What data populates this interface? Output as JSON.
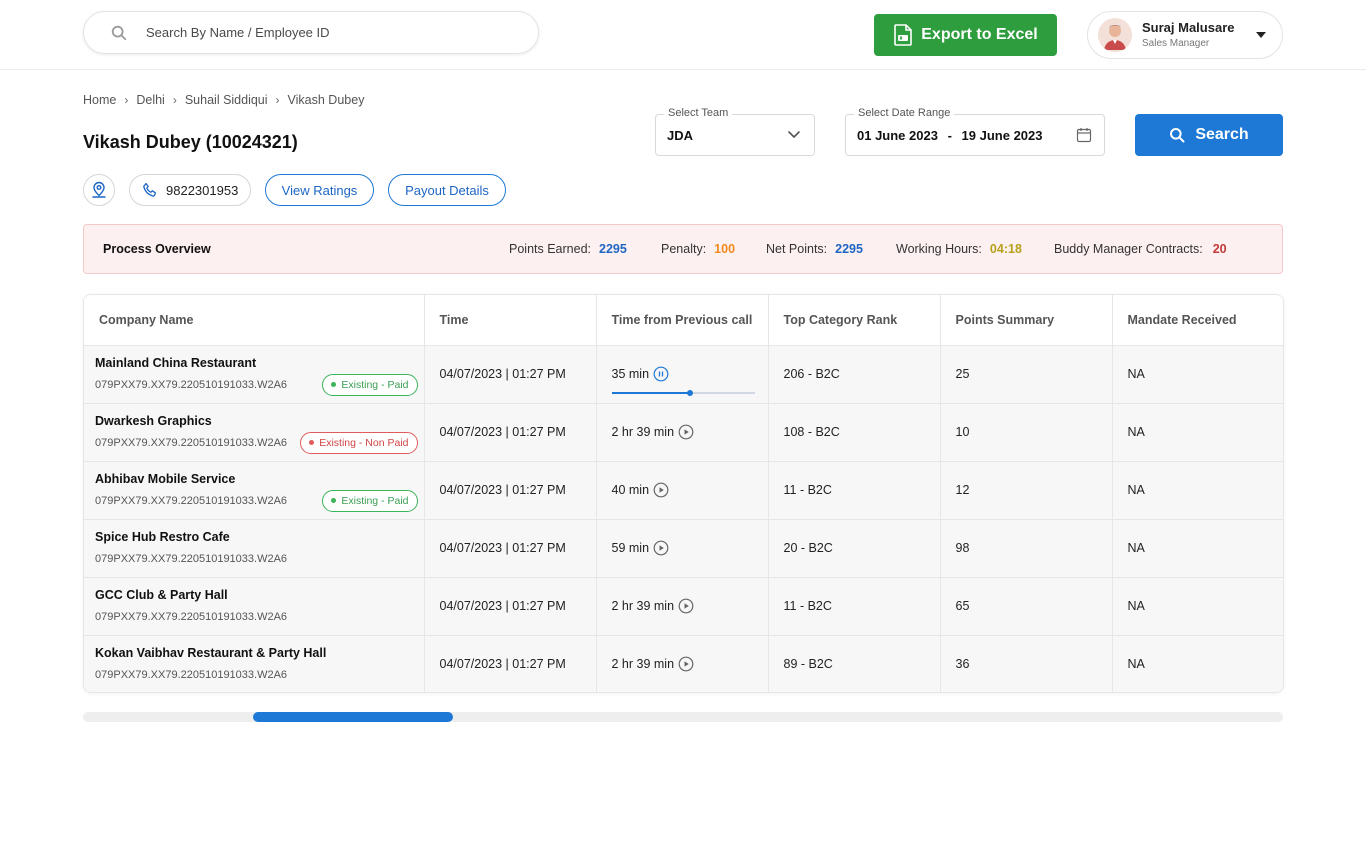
{
  "header": {
    "search": {
      "placeholder": "Search By Name / Employee ID",
      "value": ""
    },
    "export_label": "Export to Excel",
    "user": {
      "name": "Suraj Malusare",
      "role": "Sales Manager"
    }
  },
  "breadcrumb": [
    "Home",
    "Delhi",
    "Suhail Siddiqui",
    "Vikash Dubey"
  ],
  "page_title": "Vikash Dubey (10024321)",
  "filters": {
    "team": {
      "label": "Select Team",
      "value": "JDA"
    },
    "date_range": {
      "label": "Select Date Range",
      "start": "01 June 2023",
      "separator": "-",
      "end": "19 June 2023"
    },
    "search_label": "Search"
  },
  "actions": {
    "phone": "9822301953",
    "view_ratings": "View Ratings",
    "payout_details": "Payout Details"
  },
  "overview": {
    "title": "Process Overview",
    "points_earned_label": "Points Earned:",
    "points_earned": "2295",
    "penalty_label": "Penalty:",
    "penalty": "100",
    "net_points_label": "Net Points:",
    "net_points": "2295",
    "working_hours_label": "Working Hours:",
    "working_hours": "04:18",
    "buddy_label": "Buddy Manager Contracts:",
    "buddy": "20"
  },
  "table": {
    "columns": [
      "Company Name",
      "Time",
      "Time from Previous call",
      "Top Category Rank",
      "Points Summary",
      "Mandate Received"
    ],
    "rows": [
      {
        "company": "Mainland China Restaurant",
        "id": "079PXX79.XX79.220510191033.W2A6",
        "badge": "Existing - Paid",
        "badge_type": "paid",
        "time": "04/07/2023 | 01:27 PM",
        "prev_call": "35 min",
        "playing": true,
        "progress": 0.55,
        "rank": "206 - B2C",
        "points": "25",
        "mandate": "NA"
      },
      {
        "company": "Dwarkesh Graphics",
        "id": "079PXX79.XX79.220510191033.W2A6",
        "badge": "Existing -  Non Paid",
        "badge_type": "nonpaid",
        "time": "04/07/2023 | 01:27 PM",
        "prev_call": "2 hr 39 min",
        "playing": false,
        "rank": "108 - B2C",
        "points": "10",
        "mandate": "NA"
      },
      {
        "company": "Abhibav Mobile Service",
        "id": "079PXX79.XX79.220510191033.W2A6",
        "badge": "Existing - Paid",
        "badge_type": "paid",
        "time": "04/07/2023 | 01:27 PM",
        "prev_call": "40 min",
        "playing": false,
        "rank": "11 - B2C",
        "points": "12",
        "mandate": "NA"
      },
      {
        "company": "Spice Hub Restro Cafe",
        "id": "079PXX79.XX79.220510191033.W2A6",
        "badge": "",
        "badge_type": "",
        "time": "04/07/2023 | 01:27 PM",
        "prev_call": "59 min",
        "playing": false,
        "rank": "20 - B2C",
        "points": "98",
        "mandate": "NA"
      },
      {
        "company": "GCC Club & Party Hall",
        "id": "079PXX79.XX79.220510191033.W2A6",
        "badge": "",
        "badge_type": "",
        "time": "04/07/2023 | 01:27 PM",
        "prev_call": "2 hr 39 min",
        "playing": false,
        "rank": "11 - B2C",
        "points": "65",
        "mandate": "NA"
      },
      {
        "company": "Kokan Vaibhav Restaurant & Party Hall",
        "id": "079PXX79.XX79.220510191033.W2A6",
        "badge": "",
        "badge_type": "",
        "time": "04/07/2023 | 01:27 PM",
        "prev_call": "2 hr 39 min",
        "playing": false,
        "rank": "89 - B2C",
        "points": "36",
        "mandate": "NA"
      }
    ]
  },
  "colors": {
    "primary": "#1e79d6",
    "excel_green": "#2e9d3e",
    "overview_bg": "#fdf0f0",
    "paid": "#3db35a",
    "nonpaid": "#e05b5b"
  },
  "icons": {
    "search": "search-icon",
    "excel": "excel-file-icon",
    "avatar": "user-avatar",
    "caret": "caret-down-icon",
    "chevron": "chevron-down-icon",
    "calendar": "calendar-icon",
    "location": "location-pin-icon",
    "phone": "phone-icon",
    "play": "play-icon",
    "pause": "pause-icon"
  }
}
